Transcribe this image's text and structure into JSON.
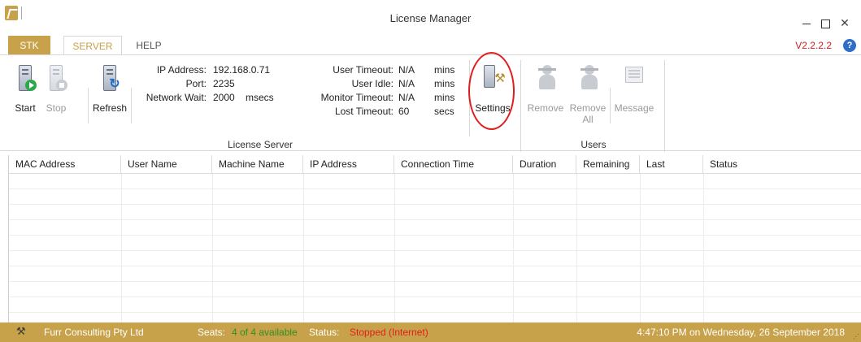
{
  "window": {
    "title": "License Manager",
    "version": "V2.2.2.2"
  },
  "tabs": [
    {
      "label": "STK",
      "active": false
    },
    {
      "label": "SERVER",
      "active": true
    },
    {
      "label": "HELP",
      "active": false
    }
  ],
  "ribbon": {
    "start_label": "Start",
    "stop_label": "Stop",
    "refresh_label": "Refresh",
    "ip_address_label": "IP Address:",
    "ip_address_value": "192.168.0.71",
    "port_label": "Port:",
    "port_value": "2235",
    "network_wait_label": "Network Wait:",
    "network_wait_value": "2000",
    "network_wait_unit": "msecs",
    "user_timeout_label": "User Timeout:",
    "user_timeout_value": "N/A",
    "user_timeout_unit": "mins",
    "user_idle_label": "User Idle:",
    "user_idle_value": "N/A",
    "user_idle_unit": "mins",
    "monitor_timeout_label": "Monitor Timeout:",
    "monitor_timeout_value": "N/A",
    "monitor_timeout_unit": "mins",
    "lost_timeout_label": "Lost Timeout:",
    "lost_timeout_value": "60",
    "lost_timeout_unit": "secs",
    "settings_label": "Settings",
    "remove_label": "Remove",
    "remove_all_label_1": "Remove",
    "remove_all_label_2": "All",
    "message_label": "Message",
    "group_license_server": "License Server",
    "group_users": "Users"
  },
  "table": {
    "columns": [
      "MAC Address",
      "User Name",
      "Machine Name",
      "IP Address",
      "Connection Time",
      "Duration",
      "Remaining",
      "Last",
      "Status"
    ],
    "rows": []
  },
  "statusbar": {
    "company": "Furr Consulting Pty Ltd",
    "seats_label": "Seats:",
    "seats_value": "4 of 4 available",
    "status_label": "Status:",
    "status_value": "Stopped (Internet)",
    "datetime": "4:47:10 PM on Wednesday, 26 September 2018"
  },
  "colors": {
    "accent": "#c8a24a",
    "version": "#d02020",
    "seats": "#2f8f1f",
    "stopped": "#e01e1e",
    "highlight": "#e01e1e"
  },
  "icons": {
    "app": "app-logo-icon",
    "start": "server-start-icon",
    "stop": "server-stop-icon",
    "refresh": "server-refresh-icon",
    "settings": "server-settings-icon",
    "remove": "user-remove-icon",
    "remove_all": "users-remove-all-icon",
    "message": "message-icon",
    "help": "help-icon",
    "status": "wrench-icon"
  }
}
